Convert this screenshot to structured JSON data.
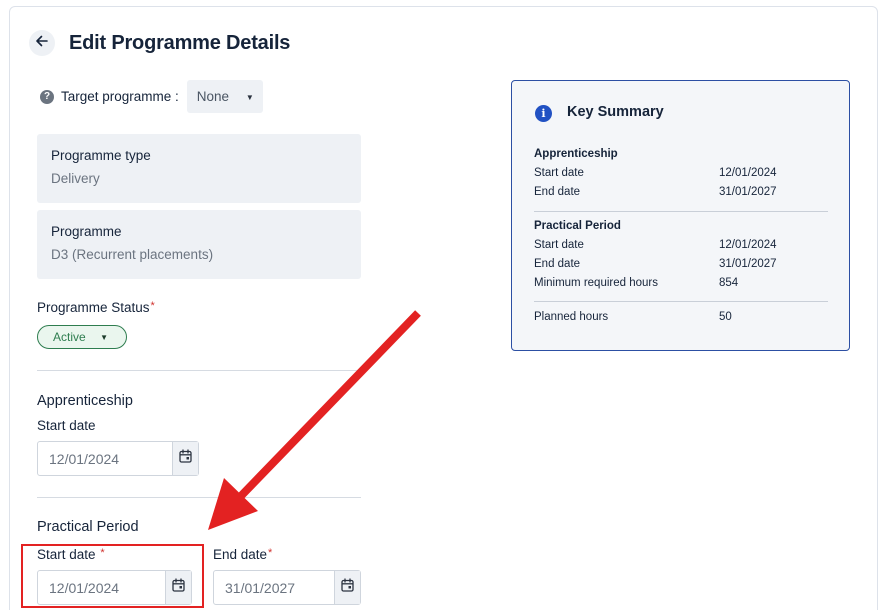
{
  "header": {
    "title": "Edit Programme Details",
    "back_icon": "arrow-left-icon"
  },
  "target_programme": {
    "label": "Target programme :",
    "selected": "None"
  },
  "programme_type": {
    "label": "Programme type",
    "value": "Delivery"
  },
  "programme": {
    "label": "Programme",
    "value": "D3 (Recurrent placements)"
  },
  "programme_status": {
    "label": "Programme Status",
    "required_mark": "*",
    "value": "Active"
  },
  "apprenticeship": {
    "title": "Apprenticeship",
    "start_label": "Start date",
    "start_value": "12/01/2024"
  },
  "practical_period": {
    "title": "Practical Period",
    "start_label": "Start date",
    "start_value": "12/01/2024",
    "end_label": "End date",
    "end_value": "31/01/2027",
    "required_mark": "*"
  },
  "summary": {
    "title": "Key Summary",
    "apprenticeship": {
      "heading": "Apprenticeship",
      "rows": [
        {
          "k": "Start date",
          "v": "12/01/2024"
        },
        {
          "k": "End date",
          "v": "31/01/2027"
        }
      ]
    },
    "practical": {
      "heading": "Practical Period",
      "rows": [
        {
          "k": "Start date",
          "v": "12/01/2024"
        },
        {
          "k": "End date",
          "v": "31/01/2027"
        },
        {
          "k": "Minimum required hours",
          "v": "854"
        }
      ]
    },
    "planned": {
      "k": "Planned hours",
      "v": "50"
    }
  },
  "colors": {
    "accent_blue": "#2151c3",
    "status_green": "#2e7d4f",
    "annotation_red": "#e32222",
    "field_bg": "#eef1f5"
  }
}
